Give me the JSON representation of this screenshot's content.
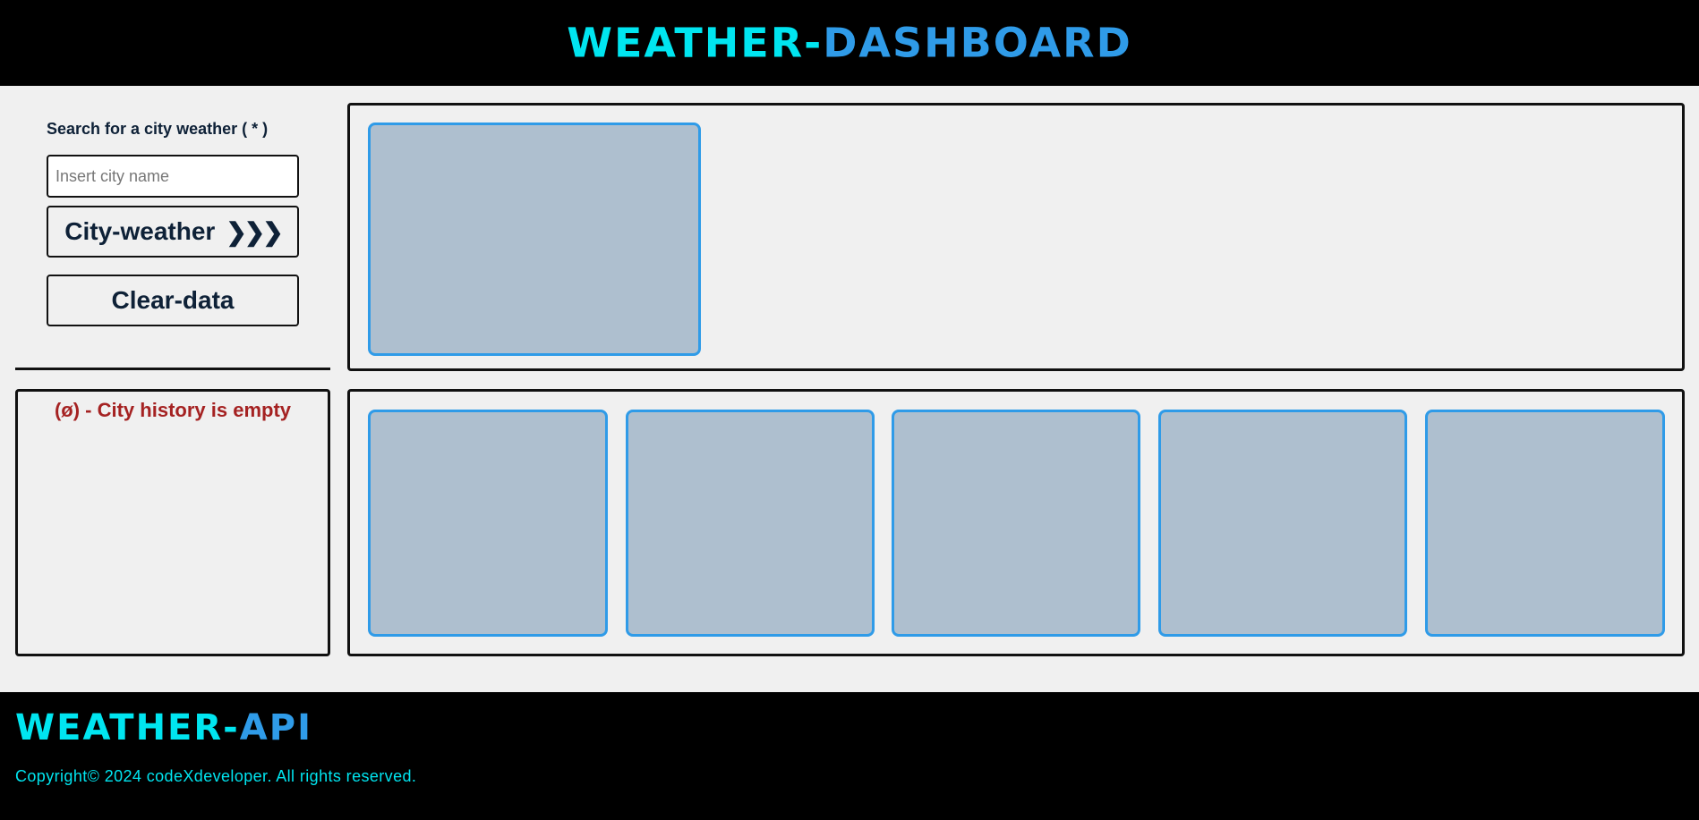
{
  "header": {
    "brand_part1": "WEATHER-",
    "brand_part2": "DASHBOARD"
  },
  "sidebar": {
    "search_label": "Search for a city weather ( * )",
    "city_input": {
      "placeholder": "Insert city name",
      "value": ""
    },
    "city_weather_button": "City-weather",
    "city_weather_chevrons": "❯❯❯",
    "clear_button": "Clear-data",
    "history_empty_text": "(ø) - City history is empty"
  },
  "footer": {
    "brand_part1": "WEATHER-",
    "brand_part2": "API",
    "copyright": "Copyright© 2024 codeXdeveloper. All rights reserved."
  },
  "colors": {
    "header_bg": "#000000",
    "brand_cyan": "#00e5f0",
    "brand_blue": "#2f9be8",
    "card_fill": "#aebfcf",
    "history_empty_red": "#a52222",
    "dark_text": "#0e2137"
  }
}
